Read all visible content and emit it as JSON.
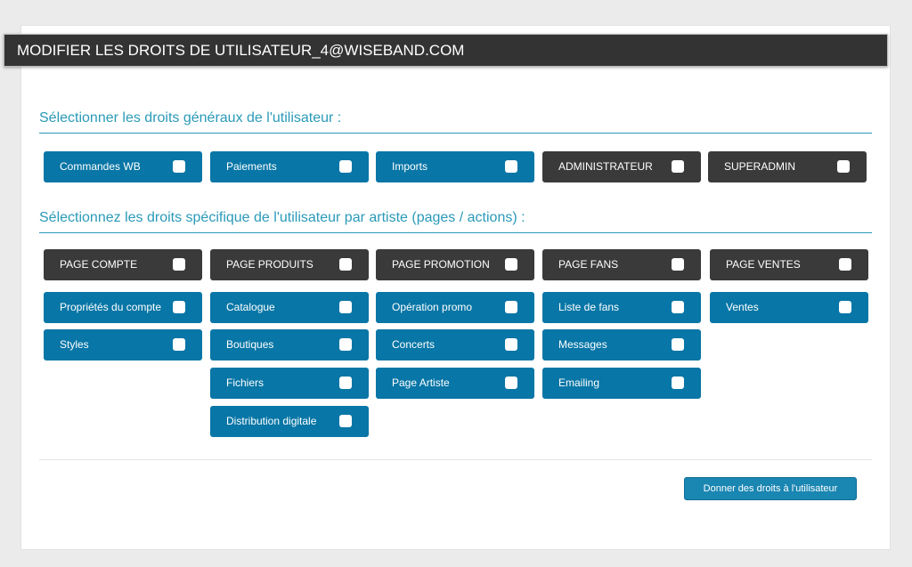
{
  "header": {
    "title": "MODIFIER LES DROITS DE UTILISATEUR_4@WISEBAND.COM"
  },
  "general_section": {
    "title": "Sélectionner les droits généraux de l'utilisateur :",
    "items": [
      {
        "label": "Commandes WB",
        "checked": false
      },
      {
        "label": "Paiements",
        "checked": false
      },
      {
        "label": "Imports",
        "checked": false
      },
      {
        "label": "ADMINISTRATEUR",
        "checked": false
      },
      {
        "label": "SUPERADMIN",
        "checked": false
      }
    ]
  },
  "artist_section": {
    "title": "Sélectionnez les droits spécifique de l'utilisateur par artiste (pages / actions) :",
    "columns": [
      {
        "page": {
          "label": "PAGE COMPTE",
          "checked": false
        },
        "actions": [
          {
            "label": "Propriétés du compte",
            "checked": false
          },
          {
            "label": "Styles",
            "checked": false
          }
        ]
      },
      {
        "page": {
          "label": "PAGE PRODUITS",
          "checked": false
        },
        "actions": [
          {
            "label": "Catalogue",
            "checked": false
          },
          {
            "label": "Boutiques",
            "checked": false
          },
          {
            "label": "Fichiers",
            "checked": false
          },
          {
            "label": "Distribution digitale",
            "checked": false
          }
        ]
      },
      {
        "page": {
          "label": "PAGE PROMOTION",
          "checked": false
        },
        "actions": [
          {
            "label": "Opération promo",
            "checked": false
          },
          {
            "label": "Concerts",
            "checked": false
          },
          {
            "label": "Page Artiste",
            "checked": false
          }
        ]
      },
      {
        "page": {
          "label": "PAGE FANS",
          "checked": false
        },
        "actions": [
          {
            "label": "Liste de fans",
            "checked": false
          },
          {
            "label": "Messages",
            "checked": false
          },
          {
            "label": "Emailing",
            "checked": false
          }
        ]
      },
      {
        "page": {
          "label": "PAGE VENTES",
          "checked": false
        },
        "actions": [
          {
            "label": "Ventes",
            "checked": false
          }
        ]
      }
    ]
  },
  "footer": {
    "submit_label": "Donner des droits à l'utilisateur"
  },
  "colors": {
    "action_blue": "#0876a6",
    "dark": "#3a3a3a",
    "accent": "#2a9ab8",
    "button": "#1a86b2"
  }
}
